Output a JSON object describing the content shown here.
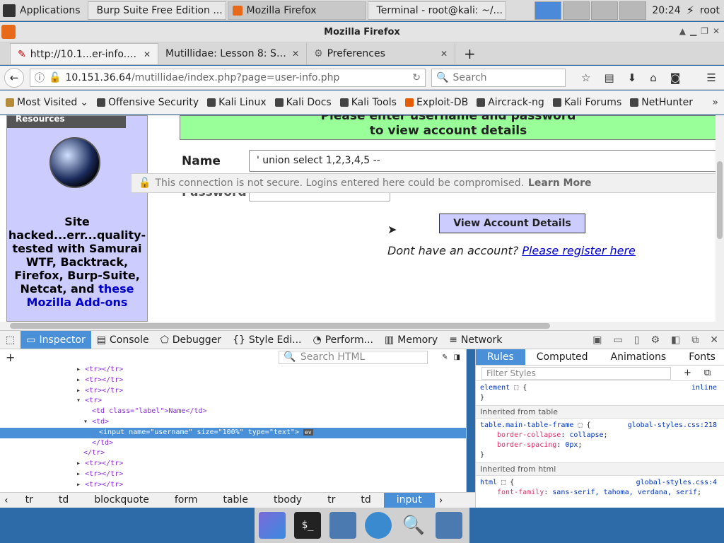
{
  "panel": {
    "apps_label": "Applications",
    "tasks": [
      {
        "label": "Burp Suite Free Edition ..."
      },
      {
        "label": "Mozilla Firefox"
      },
      {
        "label": "Terminal - root@kali: ~/..."
      }
    ],
    "clock": "20:24",
    "user": "root"
  },
  "window": {
    "title": "Mozilla Firefox"
  },
  "tabs": [
    {
      "label": "http://10.1...er-info.php"
    },
    {
      "label": "Mutillidae: Lesson 8: SQ..."
    },
    {
      "label": "Preferences"
    }
  ],
  "nav": {
    "url_host": "10.151.36.64",
    "url_rest": "/mutillidae/index.php?page=user-info.php",
    "search_placeholder": "Search"
  },
  "bookmarks": [
    "Most Visited",
    "Offensive Security",
    "Kali Linux",
    "Kali Docs",
    "Kali Tools",
    "Exploit-DB",
    "Aircrack-ng",
    "Kali Forums",
    "NetHunter"
  ],
  "page": {
    "sidebar_head": "Resources",
    "banner_l1": "Please enter username and password",
    "banner_l2": "to view account details",
    "name_label": "Name",
    "name_value": "' union select 1,2,3,4,5 --",
    "password_label": "Password",
    "warning_text": "This connection is not secure. Logins entered here could be compromised.",
    "warning_link": "Learn More",
    "view_button": "View Account Details",
    "register_prompt": "Dont have an account?",
    "register_link": "Please register here",
    "sidebar_text": "Site hacked...err...quality-tested with Samurai WTF, Backtrack, Firefox, Burp-Suite, Netcat, and",
    "sidebar_link": "these Mozilla Add-ons"
  },
  "devtools": {
    "tabs": [
      "Inspector",
      "Console",
      "Debugger",
      "Style Edi...",
      "Perform...",
      "Memory",
      "Network"
    ],
    "search_html": "Search HTML",
    "markup_lines": [
      "<tr></tr>",
      "<tr></tr>",
      "<tr></tr>",
      "<tr>",
      "<td class=\"label\">Name</td>",
      "<td>",
      "<input name=\"username\" size=\"100%\" type=\"text\">",
      "</td>",
      "</tr>",
      "<tr></tr>",
      "<tr></tr>",
      "<tr></tr>"
    ],
    "breadcrumbs": [
      "tr",
      "td",
      "blockquote",
      "form",
      "table",
      "tbody",
      "tr",
      "td",
      "input"
    ],
    "rule_tabs": [
      "Rules",
      "Computed",
      "Animations",
      "Fonts"
    ],
    "filter_placeholder": "Filter Styles",
    "rules": {
      "r1_selector": "element",
      "r1_src": "inline",
      "inh1": "Inherited from table",
      "r2_selector": "table.main-table-frame",
      "r2_src": "global-styles.css:218",
      "r2_p1": "border-collapse",
      "r2_v1": "collapse",
      "r2_p2": "border-spacing",
      "r2_v2": "0px",
      "inh2": "Inherited from html",
      "r3_selector": "html",
      "r3_src": "global-styles.css:4",
      "r3_p1": "font-family",
      "r3_v1": "sans-serif, tahoma, verdana, serif"
    }
  }
}
